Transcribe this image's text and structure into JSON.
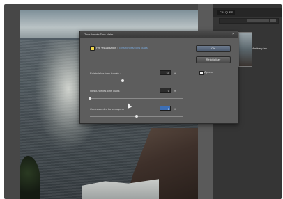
{
  "dialog": {
    "title": "Tons foncés/Tons clairs",
    "preview_label": "Pré visualisation : ",
    "preview_link": "Tons foncés/Tons clairs",
    "ok_label": "OK",
    "reset_label": "Réinitialiser",
    "help_checkbox_label": "Aperçu",
    "rows": [
      {
        "label": "Éclaircir les tons foncés :",
        "value": "35",
        "unit": "%",
        "level": 0.35
      },
      {
        "label": "Obscurcir les tons clairs :",
        "value": "0",
        "unit": "%",
        "level": 0.0
      },
      {
        "label": "Contraste des tons moyens :",
        "value": "+0",
        "unit": "%",
        "level": 0.5
      }
    ]
  },
  "right_panel": {
    "tab_label": "CALQUES",
    "layer_name": "Arrière-plan"
  }
}
